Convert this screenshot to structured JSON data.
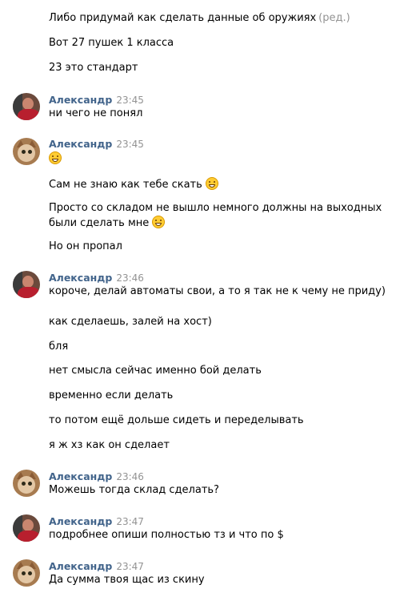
{
  "messages": {
    "m0": "Либо придумай как сделать данные об оружиях",
    "m0_edited": "(ред.)",
    "m1": "Вот 27 пушек 1 класса",
    "m2": "23 это стандарт",
    "m3": "ни чего не понял",
    "m5": "Сам не знаю как тебе скать",
    "m6a": "Просто со складом не вышло немного должны на выходных",
    "m6b": "были сделать мне",
    "m7": "Но он пропал",
    "m8": "короче, делай автоматы свои, а то я так не к чему не приду)",
    "m9": "как сделаешь, залей на хост)",
    "m10": "бля",
    "m11": "нет смысла сейчас именно бой делать",
    "m12": "временно если делать",
    "m13": "то потом ещё дольше сидеть и переделывать",
    "m14": "я ж хз как он сделает",
    "m15": "Можешь тогда склад сделать?",
    "m16": "подробнее опиши полностью тз и что по $",
    "m17": "Да сумма твоя щас из скину"
  },
  "headers": {
    "h1": {
      "name": "Александр",
      "time": "23:45"
    },
    "h2": {
      "name": "Александр",
      "time": "23:45"
    },
    "h3": {
      "name": "Александр",
      "time": "23:46"
    },
    "h4": {
      "name": "Александр",
      "time": "23:46"
    },
    "h5": {
      "name": "Александр",
      "time": "23:47"
    },
    "h6": {
      "name": "Александр",
      "time": "23:47"
    }
  },
  "avatars": {
    "h1": "person-photo",
    "h2": "cat-photo",
    "h3": "person-photo",
    "h4": "cat-photo",
    "h5": "person-photo",
    "h6": "cat-photo"
  },
  "icons": {
    "emoji": "grinning-face-icon"
  },
  "colors": {
    "author_name": "#42648b",
    "meta": "#939393",
    "text": "#000000",
    "background": "#ffffff"
  }
}
